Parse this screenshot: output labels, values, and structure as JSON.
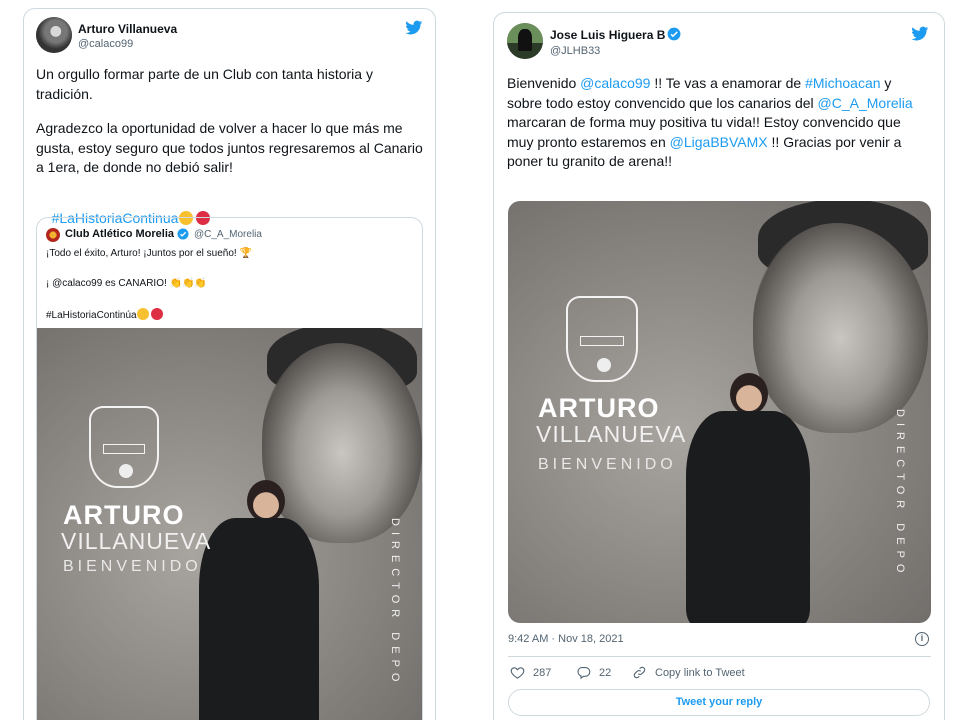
{
  "left_tweet": {
    "author_name": "Arturo Villanueva",
    "author_handle": "@calaco99",
    "text_p1": "Un orgullo formar parte de un Club con tanta historia y tradición.",
    "text_p2": "Agradezco la oportunidad de volver a hacer lo que más me gusta, estoy seguro que todos juntos regresaremos al Canario a 1era, de donde no debió salir!",
    "hashtag": "#LaHistoriaContinua",
    "quote": {
      "author_name": "Club Atlético Morelia",
      "author_handle": "@C_A_Morelia",
      "line1": "¡Todo el éxito, Arturo! ¡Juntos por el sueño! 🏆",
      "line2": "¡ @calaco99 es CANARIO! 👏👏👏",
      "line3": "#LaHistoriaContinúa",
      "poster": {
        "crest_text": "ATLETICO MORELIA",
        "name_first": "ARTURO",
        "name_last": "VILLANUEVA",
        "welcome": "BIENVENIDO",
        "role": "DIRECTOR DEPO"
      }
    }
  },
  "right_tweet": {
    "author_name": "Jose Luis Higuera B",
    "author_handle": "@JLHB33",
    "text": {
      "t1": "Bienvenido ",
      "m1": "@calaco99",
      "t2": " !! Te vas a enamorar de ",
      "h1": "#Michoacan",
      "t3": " y sobre todo estoy convencido que los canarios del ",
      "m2": "@C_A_Morelia",
      "t4": " marcaran de forma muy positiva tu vida!! Estoy convencido que muy pronto estaremos en ",
      "m3": "@LigaBBVAMX",
      "t5": " !! Gracias por venir a poner tu granito de arena!!"
    },
    "poster": {
      "crest_text": "ATLETICO MORELIA",
      "name_first": "ARTURO",
      "name_last": "VILLANUEVA",
      "welcome": "BIENVENIDO",
      "role": "DIRECTOR DEPO"
    },
    "timestamp": "9:42 AM · Nov 18, 2021",
    "likes": "287",
    "replies": "22",
    "copy_link": "Copy link to Tweet",
    "reply_button": "Tweet your reply"
  },
  "colors": {
    "twitter_blue": "#1d9bf0",
    "verified_blue": "#1d9bf0",
    "yellow_dot": "#f7c02e",
    "red_dot": "#dd2e44"
  },
  "icons": [
    "twitter-bird-icon",
    "verified-badge-icon",
    "info-icon",
    "heart-icon",
    "reply-icon",
    "link-icon"
  ]
}
